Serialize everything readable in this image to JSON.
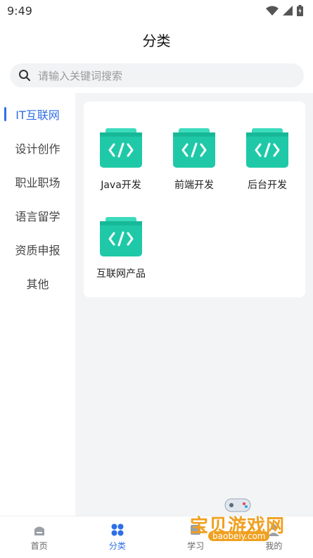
{
  "status": {
    "time": "9:49"
  },
  "header": {
    "title": "分类"
  },
  "search": {
    "placeholder": "请输入关键词搜索"
  },
  "sidebar": {
    "items": [
      {
        "label": "IT互联网",
        "active": true
      },
      {
        "label": "设计创作"
      },
      {
        "label": "职业职场"
      },
      {
        "label": "语言留学"
      },
      {
        "label": "资质申报"
      },
      {
        "label": "其他"
      }
    ]
  },
  "categories": [
    {
      "label": "Java开发",
      "icon": "code-folder-icon"
    },
    {
      "label": "前端开发",
      "icon": "code-folder-icon"
    },
    {
      "label": "后台开发",
      "icon": "code-folder-icon"
    },
    {
      "label": "互联网产品",
      "icon": "code-folder-icon"
    }
  ],
  "tabbar": {
    "tabs": [
      {
        "label": "首页",
        "icon": "home-icon"
      },
      {
        "label": "分类",
        "icon": "category-icon",
        "active": true
      },
      {
        "label": "学习",
        "icon": "study-icon"
      },
      {
        "label": "我的",
        "icon": "profile-icon"
      }
    ]
  },
  "watermark": {
    "text": "宝贝游戏网",
    "url": "baobeiy.com"
  },
  "colors": {
    "accent": "#2f6fe6",
    "icon_green": "#1fc9a8"
  }
}
